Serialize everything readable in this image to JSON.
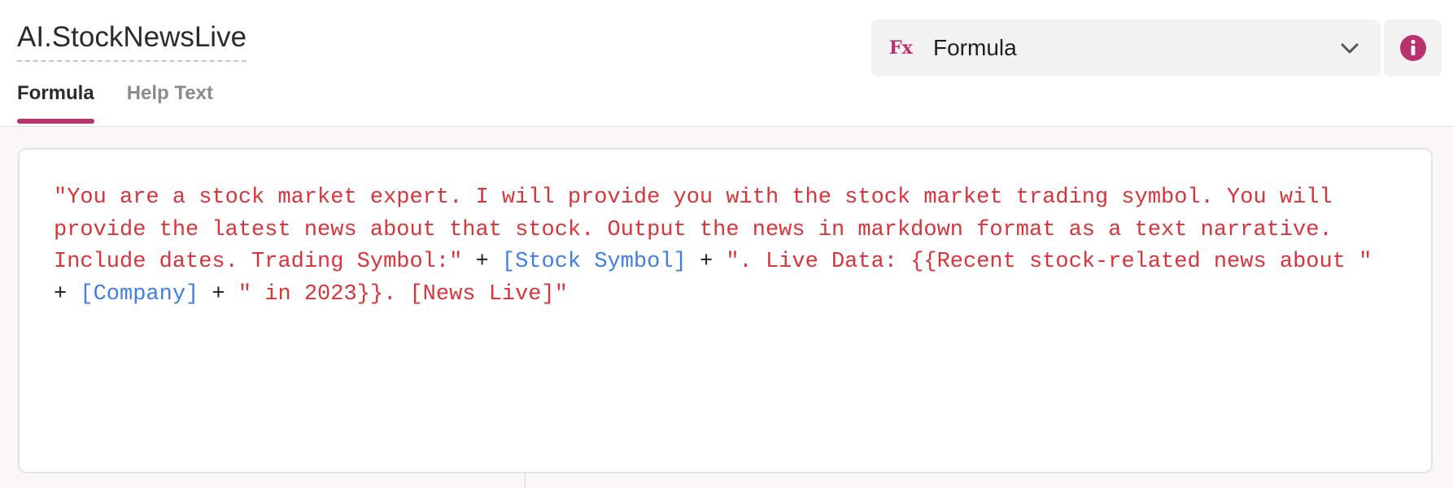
{
  "field": {
    "name": "AI.StockNewsLive"
  },
  "tabs": [
    {
      "label": "Formula",
      "active": true
    },
    {
      "label": "Help Text",
      "active": false
    }
  ],
  "mode_select": {
    "icon_text": "Fx",
    "value": "Formula",
    "icon": "chevron-down-icon"
  },
  "info_button": {
    "icon": "info-icon"
  },
  "formula": {
    "tokens": [
      {
        "type": "string",
        "text": "\"You are a stock market expert. I will provide you with the stock market trading symbol. You will provide the latest news about that stock. Output the news in markdown format as a text narrative. Include dates. Trading Symbol:\""
      },
      {
        "type": "operator",
        "text": " + "
      },
      {
        "type": "field",
        "text": "[Stock Symbol]"
      },
      {
        "type": "operator",
        "text": " + "
      },
      {
        "type": "string",
        "text": "\". Live Data: {{Recent stock-related news about \""
      },
      {
        "type": "operator",
        "text": " + "
      },
      {
        "type": "field",
        "text": "[Company]"
      },
      {
        "type": "operator",
        "text": " + "
      },
      {
        "type": "string",
        "text": "\" in 2023}}. [News Live]\""
      }
    ]
  },
  "colors": {
    "accent": "#b8326d",
    "string_token": "#d8343a",
    "field_token": "#3f7fe3",
    "operator_token": "#1f1f22"
  }
}
